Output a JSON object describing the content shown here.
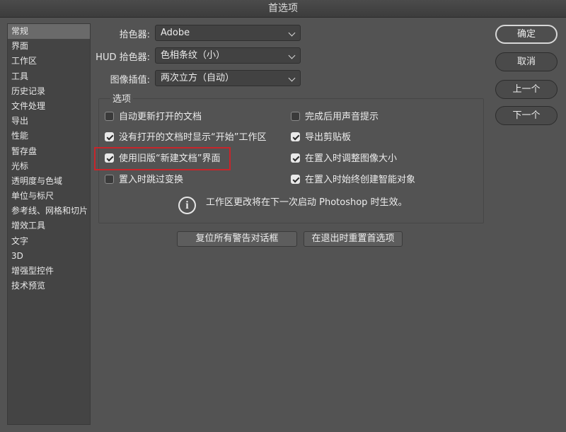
{
  "window": {
    "title": "首选项"
  },
  "sidebar": {
    "items": [
      {
        "label": "常规",
        "selected": true
      },
      {
        "label": "界面"
      },
      {
        "label": "工作区"
      },
      {
        "label": "工具"
      },
      {
        "label": "历史记录"
      },
      {
        "label": "文件处理"
      },
      {
        "label": "导出"
      },
      {
        "label": "性能"
      },
      {
        "label": "暂存盘"
      },
      {
        "label": "光标"
      },
      {
        "label": "透明度与色域"
      },
      {
        "label": "单位与标尺"
      },
      {
        "label": "参考线、网格和切片"
      },
      {
        "label": "增效工具"
      },
      {
        "label": "文字"
      },
      {
        "label": "3D"
      },
      {
        "label": "增强型控件"
      },
      {
        "label": "技术预览"
      }
    ]
  },
  "fields": {
    "color_picker": {
      "label": "拾色器:",
      "value": "Adobe"
    },
    "hud_color_picker": {
      "label": "HUD 拾色器:",
      "value": "色相条纹（小）"
    },
    "image_interpolation": {
      "label": "图像插值:",
      "value": "两次立方（自动）"
    }
  },
  "options": {
    "title": "选项",
    "auto_update_docs": {
      "label": "自动更新打开的文档",
      "checked": false
    },
    "show_start_workspace": {
      "label": "没有打开的文档时显示“开始”工作区",
      "checked": true
    },
    "legacy_new_doc": {
      "label": "使用旧版“新建文档”界面",
      "checked": true
    },
    "skip_transform_on_place": {
      "label": "置入时跳过变换",
      "checked": false
    },
    "beep_when_done": {
      "label": "完成后用声音提示",
      "checked": false
    },
    "export_clipboard": {
      "label": "导出剪贴板",
      "checked": true
    },
    "resize_on_place": {
      "label": "在置入时调整图像大小",
      "checked": true
    },
    "always_smart_objects": {
      "label": "在置入时始终创建智能对象",
      "checked": true
    },
    "info_text": "工作区更改将在下一次启动 Photoshop 时生效。"
  },
  "buttons": {
    "reset_warnings": "复位所有警告对话框",
    "reset_prefs_on_quit": "在退出时重置首选项",
    "ok": "确定",
    "cancel": "取消",
    "prev": "上一个",
    "next": "下一个"
  },
  "colors": {
    "highlight_box": "#c8252b",
    "background": "#535353"
  }
}
